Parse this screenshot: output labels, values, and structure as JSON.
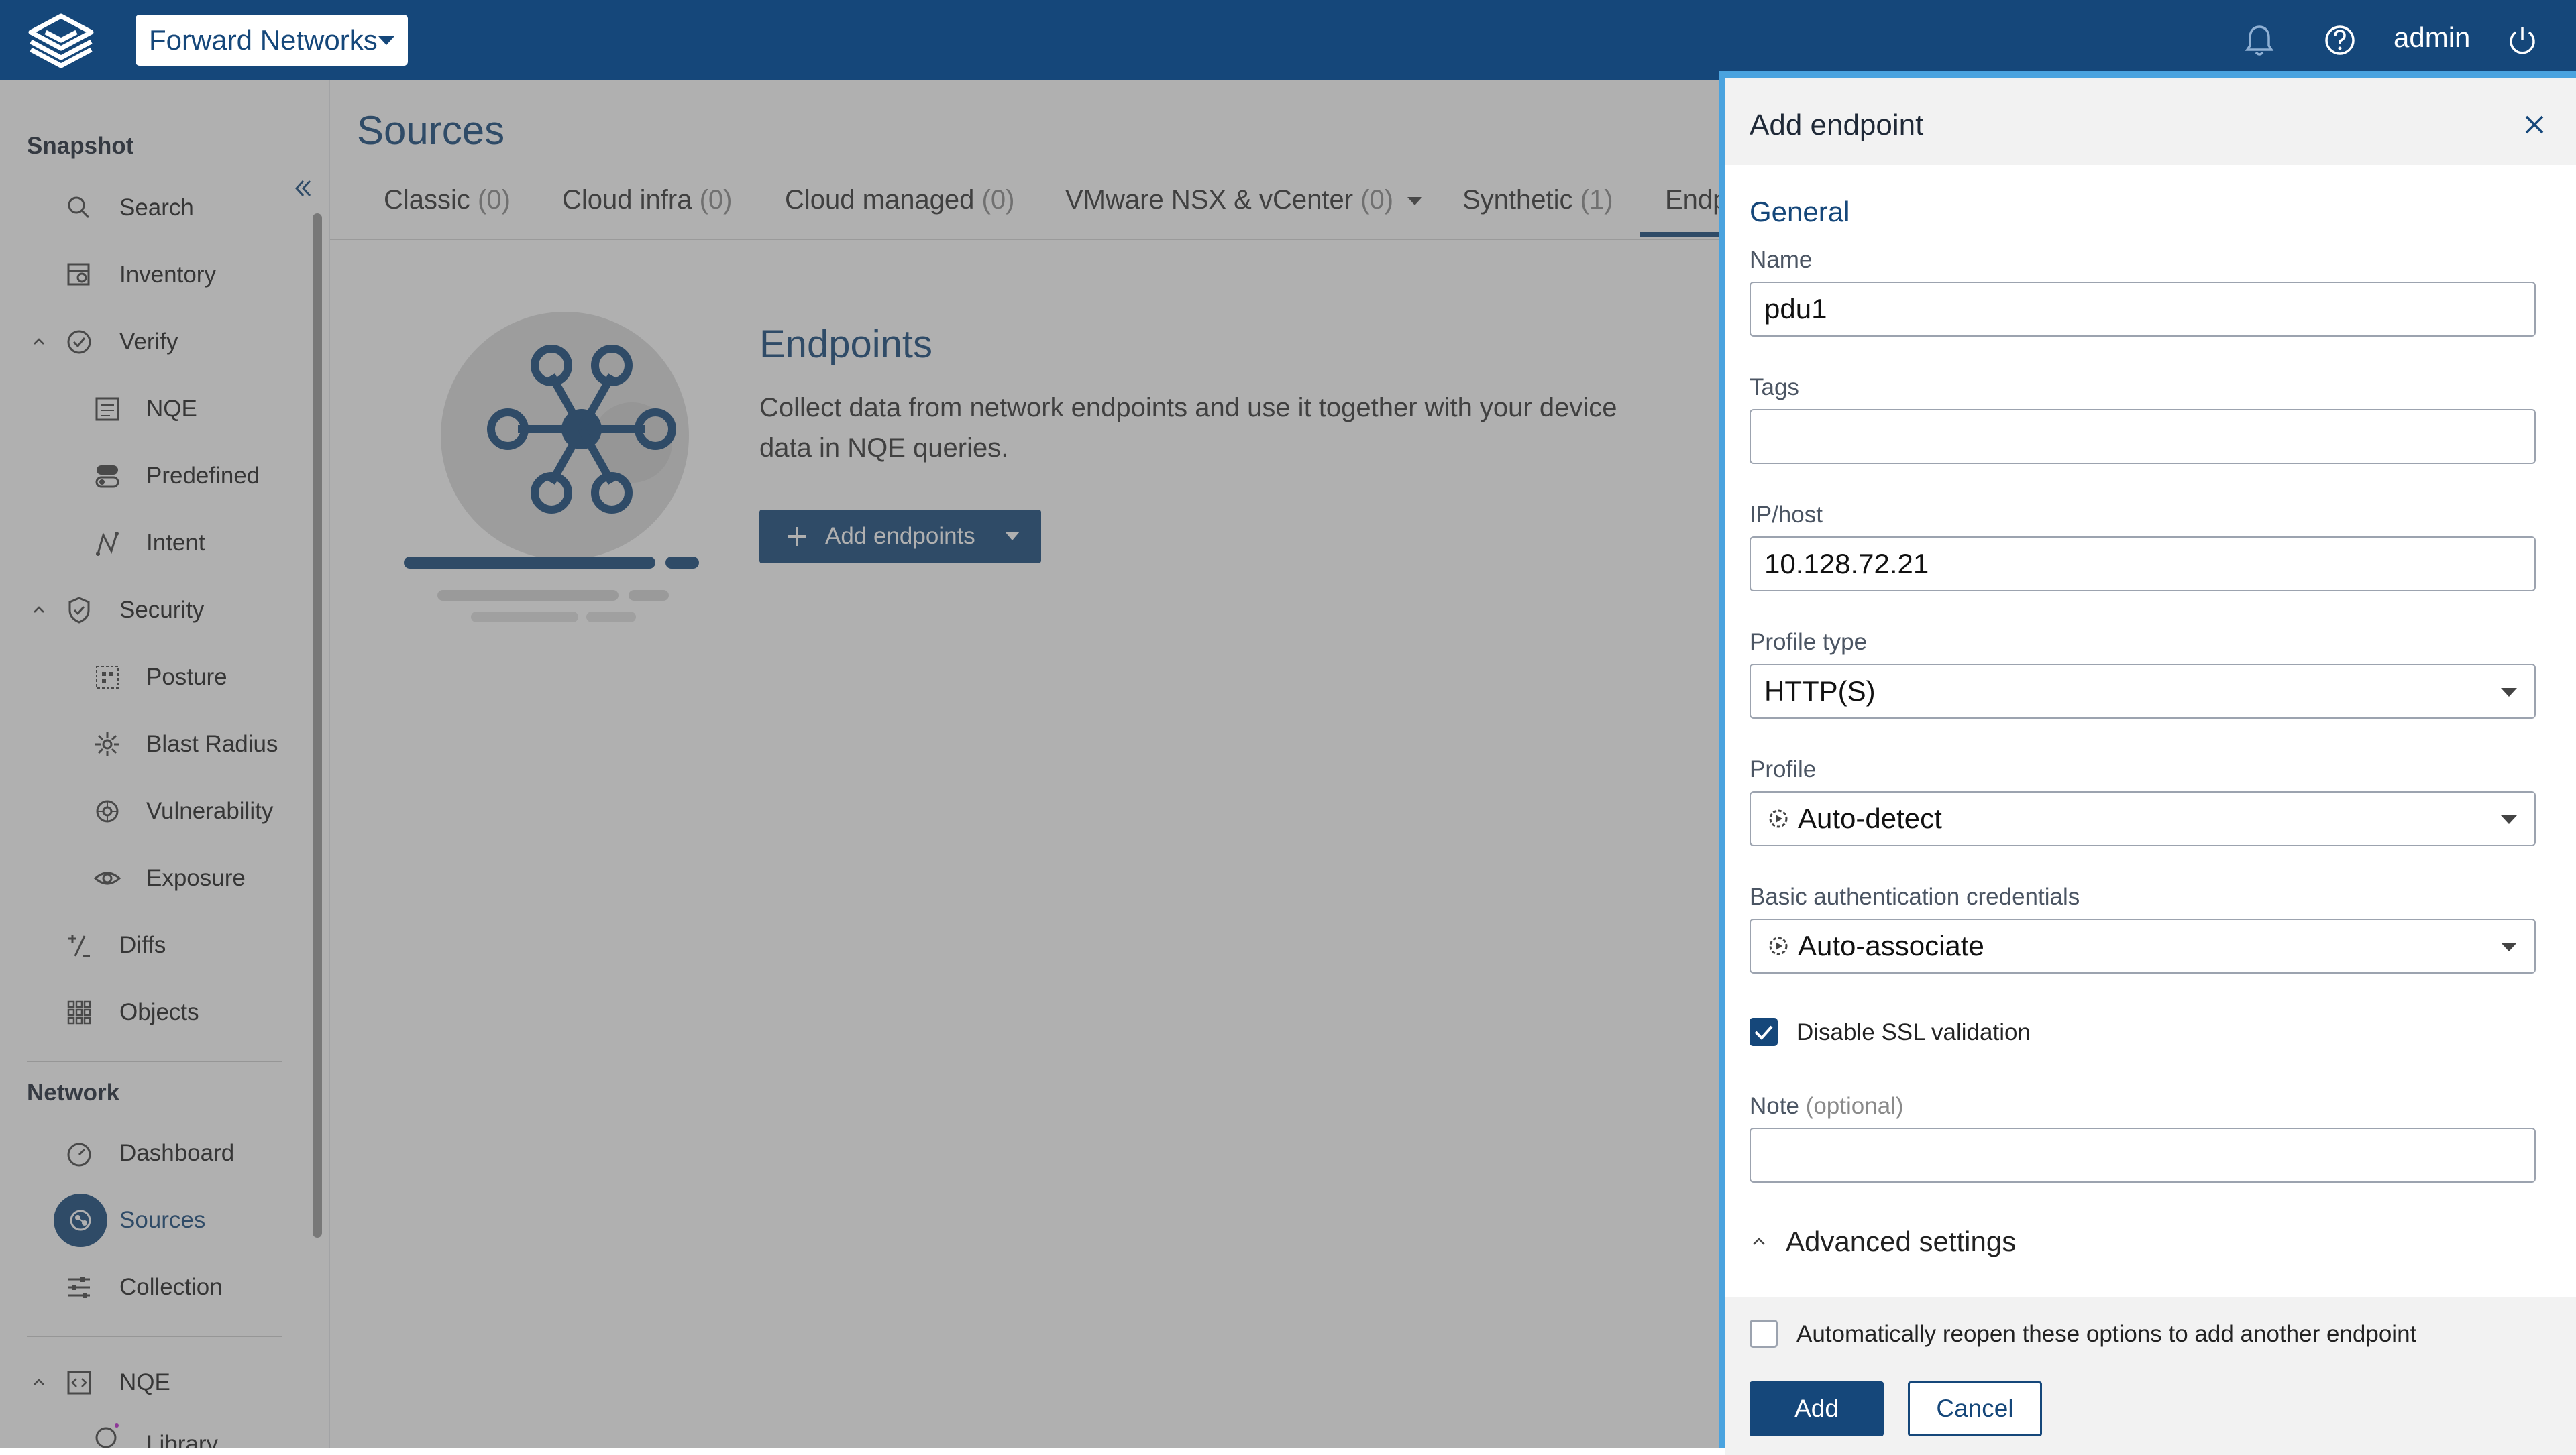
{
  "topbar": {
    "org": "Forward Networks",
    "user": "admin",
    "icons": [
      "logo-icon",
      "bell-icon",
      "help-icon",
      "power-icon"
    ]
  },
  "sidebar": {
    "sections": {
      "snapshot": "Snapshot",
      "network": "Network"
    },
    "items": {
      "search": "Search",
      "inventory": "Inventory",
      "verify": "Verify",
      "nqe": "NQE",
      "predefined": "Predefined",
      "intent": "Intent",
      "security": "Security",
      "posture": "Posture",
      "blast_radius": "Blast Radius",
      "vulnerability": "Vulnerability",
      "exposure": "Exposure",
      "diffs": "Diffs",
      "objects": "Objects",
      "dashboard": "Dashboard",
      "sources": "Sources",
      "collection": "Collection",
      "nqe_group": "NQE",
      "library": "Library"
    }
  },
  "main": {
    "title": "Sources",
    "tabs": [
      {
        "label": "Classic",
        "count": "(0)"
      },
      {
        "label": "Cloud infra",
        "count": "(0)"
      },
      {
        "label": "Cloud managed",
        "count": "(0)"
      },
      {
        "label": "VMware NSX & vCenter",
        "count": "(0)"
      },
      {
        "label": "Synthetic",
        "count": "(1)"
      },
      {
        "label": "Endp",
        "count": ""
      }
    ],
    "endpoints": {
      "title": "Endpoints",
      "description": "Collect data from network endpoints and use it together with your device data in NQE queries.",
      "add_button": "Add endpoints"
    }
  },
  "panel": {
    "title": "Add endpoint",
    "section": "General",
    "name_label": "Name",
    "name_value": "pdu1",
    "tags_label": "Tags",
    "tags_value": "",
    "ip_label": "IP/host",
    "ip_value": "10.128.72.21",
    "profile_type_label": "Profile type",
    "profile_type_value": "HTTP(S)",
    "profile_label": "Profile",
    "profile_value": "Auto-detect",
    "cred_label": "Basic authentication credentials",
    "cred_value": "Auto-associate",
    "ssl_label": "Disable SSL validation",
    "ssl_checked": true,
    "note_label": "Note",
    "note_optional": "(optional)",
    "note_value": "",
    "advanced": "Advanced settings",
    "reopen_label": "Automatically reopen these options to add another endpoint",
    "reopen_checked": false,
    "add": "Add",
    "cancel": "Cancel"
  },
  "colors": {
    "brand": "#15477a",
    "panel_border": "#4aa3df"
  }
}
